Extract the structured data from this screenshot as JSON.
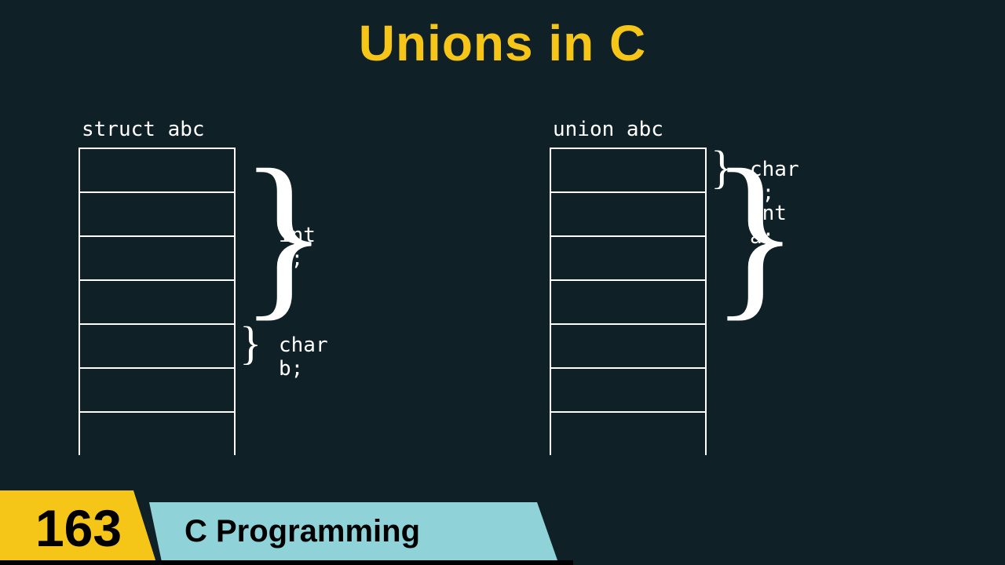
{
  "title": "Unions in C",
  "left": {
    "label": "struct abc",
    "cells": 7,
    "annotations": [
      {
        "text": "int a;",
        "rowStart": 0,
        "rowSpan": 4
      },
      {
        "text": "char b;",
        "rowStart": 4,
        "rowSpan": 1
      }
    ]
  },
  "right": {
    "label": "union abc",
    "cells": 7,
    "annotations": [
      {
        "text": "char b;",
        "rowStart": 0,
        "rowSpan": 1
      },
      {
        "text": "int a;",
        "rowStart": 0,
        "rowSpan": 4
      }
    ]
  },
  "footer": {
    "number": "163",
    "label": "C Programming"
  }
}
